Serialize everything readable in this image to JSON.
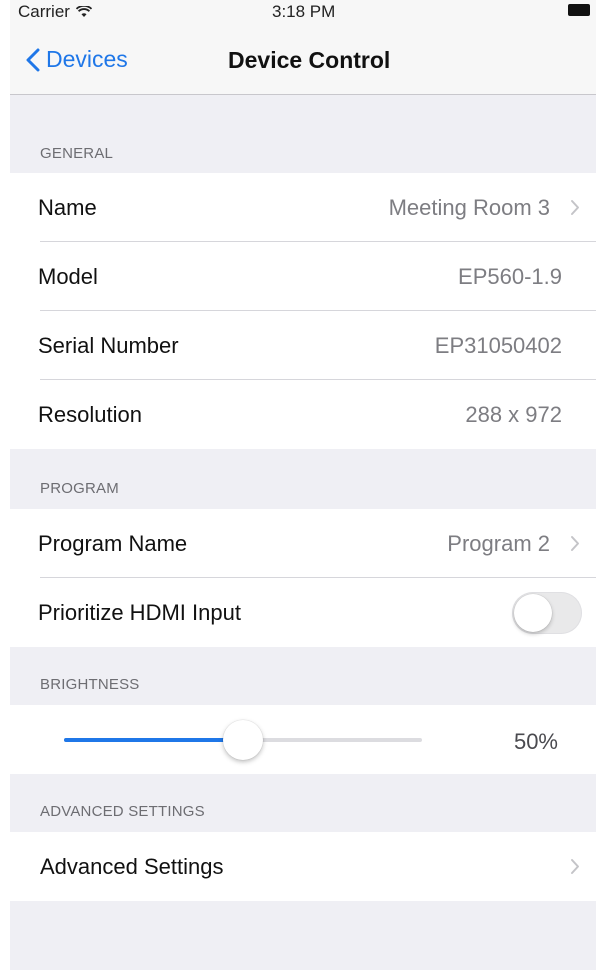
{
  "status_bar": {
    "carrier": "Carrier",
    "time": "3:18 PM"
  },
  "nav": {
    "back_label": "Devices",
    "title": "Device Control"
  },
  "sections": {
    "general": {
      "header": "GENERAL",
      "rows": [
        {
          "label": "Name",
          "value": "Meeting Room 3"
        },
        {
          "label": "Model",
          "value": "EP560-1.9"
        },
        {
          "label": "Serial Number",
          "value": "EP31050402"
        },
        {
          "label": "Resolution",
          "value": "288 x 972"
        }
      ]
    },
    "program": {
      "header": "PROGRAM",
      "program_name_label": "Program Name",
      "program_name_value": "Program 2",
      "hdmi_label": "Prioritize HDMI Input",
      "hdmi_enabled": false
    },
    "brightness": {
      "header": "BRIGHTNESS",
      "value": 0.5,
      "value_label": "50%"
    },
    "advanced": {
      "header": "ADVANCED SETTINGS",
      "row_label": "Advanced Settings"
    }
  },
  "colors": {
    "accent": "#1f77e8",
    "background": "#efeff4",
    "separator": "#d6d6db"
  }
}
